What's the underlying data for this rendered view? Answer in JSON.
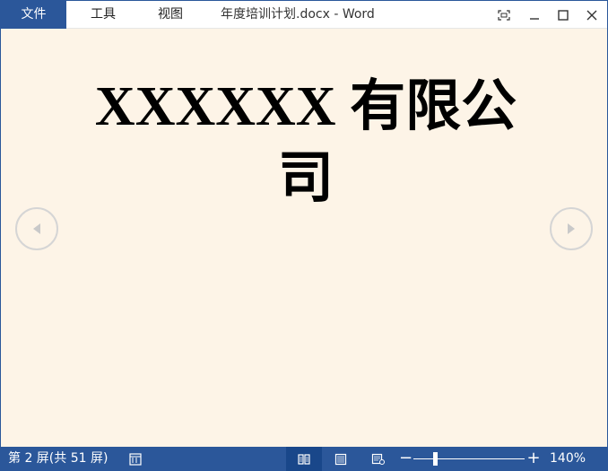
{
  "titlebar": {
    "file_tab": "文件",
    "menu": {
      "tools": "工具",
      "view": "视图"
    },
    "document_title": "年度培训计划.docx - Word",
    "window_buttons": [
      "fullscreen-icon",
      "minimize-icon",
      "maximize-icon",
      "close-icon"
    ]
  },
  "document": {
    "heading": "XXXXXX 有限公司"
  },
  "navigation": {
    "prev_icon": "chevron-left-icon",
    "next_icon": "chevron-right-icon"
  },
  "statusbar": {
    "page_info": "第 2 屏(共 51 屏)",
    "zoom_level": "140%",
    "zoom_minus": "−",
    "zoom_plus": "+",
    "zoom_fraction": 0.24
  },
  "colors": {
    "accent": "#2b579a",
    "page_background": "#fdf4e7"
  }
}
